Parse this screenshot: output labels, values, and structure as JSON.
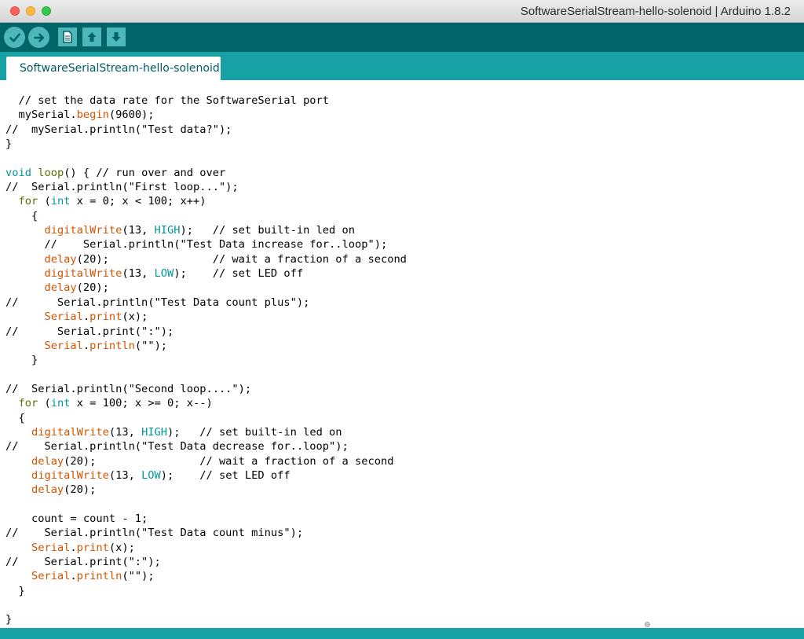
{
  "window": {
    "title": "SoftwareSerialStream-hello-solenoid | Arduino 1.8.2"
  },
  "toolbar": {
    "buttons": [
      {
        "name": "verify",
        "icon": "checkmark-icon"
      },
      {
        "name": "upload",
        "icon": "arrow-right-icon"
      },
      {
        "name": "new",
        "icon": "document-icon"
      },
      {
        "name": "open",
        "icon": "arrow-up-icon"
      },
      {
        "name": "save",
        "icon": "arrow-down-icon"
      }
    ]
  },
  "tabs": [
    {
      "label": "SoftwareSerialStream-hello-solenoid",
      "active": true
    }
  ],
  "colors": {
    "toolbar_bg": "#006468",
    "tabstrip_bg": "#17a1a5",
    "button_bg": "#4db7bb",
    "function_color": "#d35400",
    "keyword_color": "#5e6d03",
    "type_color": "#00979c"
  },
  "editor": {
    "lines": [
      [
        {
          "t": "  // set the data rate for the SoftwareSerial port"
        }
      ],
      [
        {
          "t": "  mySerial."
        },
        {
          "t": "begin",
          "c": "func"
        },
        {
          "t": "(9600);"
        }
      ],
      [
        {
          "t": "//  mySerial.println(\"Test data?\");"
        }
      ],
      [
        {
          "t": "}"
        }
      ],
      [
        {
          "t": ""
        }
      ],
      [
        {
          "t": "void",
          "c": "type"
        },
        {
          "t": " "
        },
        {
          "t": "loop",
          "c": "kw"
        },
        {
          "t": "() { // run over and over"
        }
      ],
      [
        {
          "t": "//  Serial.println(\"First loop...\");"
        }
      ],
      [
        {
          "t": "  "
        },
        {
          "t": "for",
          "c": "kw"
        },
        {
          "t": " ("
        },
        {
          "t": "int",
          "c": "type"
        },
        {
          "t": " x = 0; x < 100; x++)"
        }
      ],
      [
        {
          "t": "    {"
        }
      ],
      [
        {
          "t": "      "
        },
        {
          "t": "digitalWrite",
          "c": "func"
        },
        {
          "t": "(13, "
        },
        {
          "t": "HIGH",
          "c": "const"
        },
        {
          "t": ");   // set built-in led on"
        }
      ],
      [
        {
          "t": "      //    Serial.println(\"Test Data increase for..loop\");"
        }
      ],
      [
        {
          "t": "      "
        },
        {
          "t": "delay",
          "c": "func"
        },
        {
          "t": "(20);                // wait a fraction of a second"
        }
      ],
      [
        {
          "t": "      "
        },
        {
          "t": "digitalWrite",
          "c": "func"
        },
        {
          "t": "(13, "
        },
        {
          "t": "LOW",
          "c": "const"
        },
        {
          "t": ");    // set LED off"
        }
      ],
      [
        {
          "t": "      "
        },
        {
          "t": "delay",
          "c": "func"
        },
        {
          "t": "(20);"
        }
      ],
      [
        {
          "t": "//      Serial.println(\"Test Data count plus\");"
        }
      ],
      [
        {
          "t": "      "
        },
        {
          "t": "Serial",
          "c": "func"
        },
        {
          "t": "."
        },
        {
          "t": "print",
          "c": "func"
        },
        {
          "t": "(x);"
        }
      ],
      [
        {
          "t": "//      Serial.print(\":\");"
        }
      ],
      [
        {
          "t": "      "
        },
        {
          "t": "Serial",
          "c": "func"
        },
        {
          "t": "."
        },
        {
          "t": "println",
          "c": "func"
        },
        {
          "t": "(\"\");"
        }
      ],
      [
        {
          "t": "    }"
        }
      ],
      [
        {
          "t": ""
        }
      ],
      [
        {
          "t": "//  Serial.println(\"Second loop....\");"
        }
      ],
      [
        {
          "t": "  "
        },
        {
          "t": "for",
          "c": "kw"
        },
        {
          "t": " ("
        },
        {
          "t": "int",
          "c": "type"
        },
        {
          "t": " x = 100; x >= 0; x--)"
        }
      ],
      [
        {
          "t": "  {"
        }
      ],
      [
        {
          "t": "    "
        },
        {
          "t": "digitalWrite",
          "c": "func"
        },
        {
          "t": "(13, "
        },
        {
          "t": "HIGH",
          "c": "const"
        },
        {
          "t": ");   // set built-in led on"
        }
      ],
      [
        {
          "t": "//    Serial.println(\"Test Data decrease for..loop\");"
        }
      ],
      [
        {
          "t": "    "
        },
        {
          "t": "delay",
          "c": "func"
        },
        {
          "t": "(20);                // wait a fraction of a second"
        }
      ],
      [
        {
          "t": "    "
        },
        {
          "t": "digitalWrite",
          "c": "func"
        },
        {
          "t": "(13, "
        },
        {
          "t": "LOW",
          "c": "const"
        },
        {
          "t": ");    // set LED off"
        }
      ],
      [
        {
          "t": "    "
        },
        {
          "t": "delay",
          "c": "func"
        },
        {
          "t": "(20);"
        }
      ],
      [
        {
          "t": ""
        }
      ],
      [
        {
          "t": "    count = count - 1;"
        }
      ],
      [
        {
          "t": "//    Serial.println(\"Test Data count minus\");"
        }
      ],
      [
        {
          "t": "    "
        },
        {
          "t": "Serial",
          "c": "func"
        },
        {
          "t": "."
        },
        {
          "t": "print",
          "c": "func"
        },
        {
          "t": "(x);"
        }
      ],
      [
        {
          "t": "//    Serial.print(\":\");"
        }
      ],
      [
        {
          "t": "    "
        },
        {
          "t": "Serial",
          "c": "func"
        },
        {
          "t": "."
        },
        {
          "t": "println",
          "c": "func"
        },
        {
          "t": "(\"\");"
        }
      ],
      [
        {
          "t": "  }"
        }
      ],
      [
        {
          "t": ""
        }
      ],
      [
        {
          "t": "}"
        }
      ]
    ]
  }
}
